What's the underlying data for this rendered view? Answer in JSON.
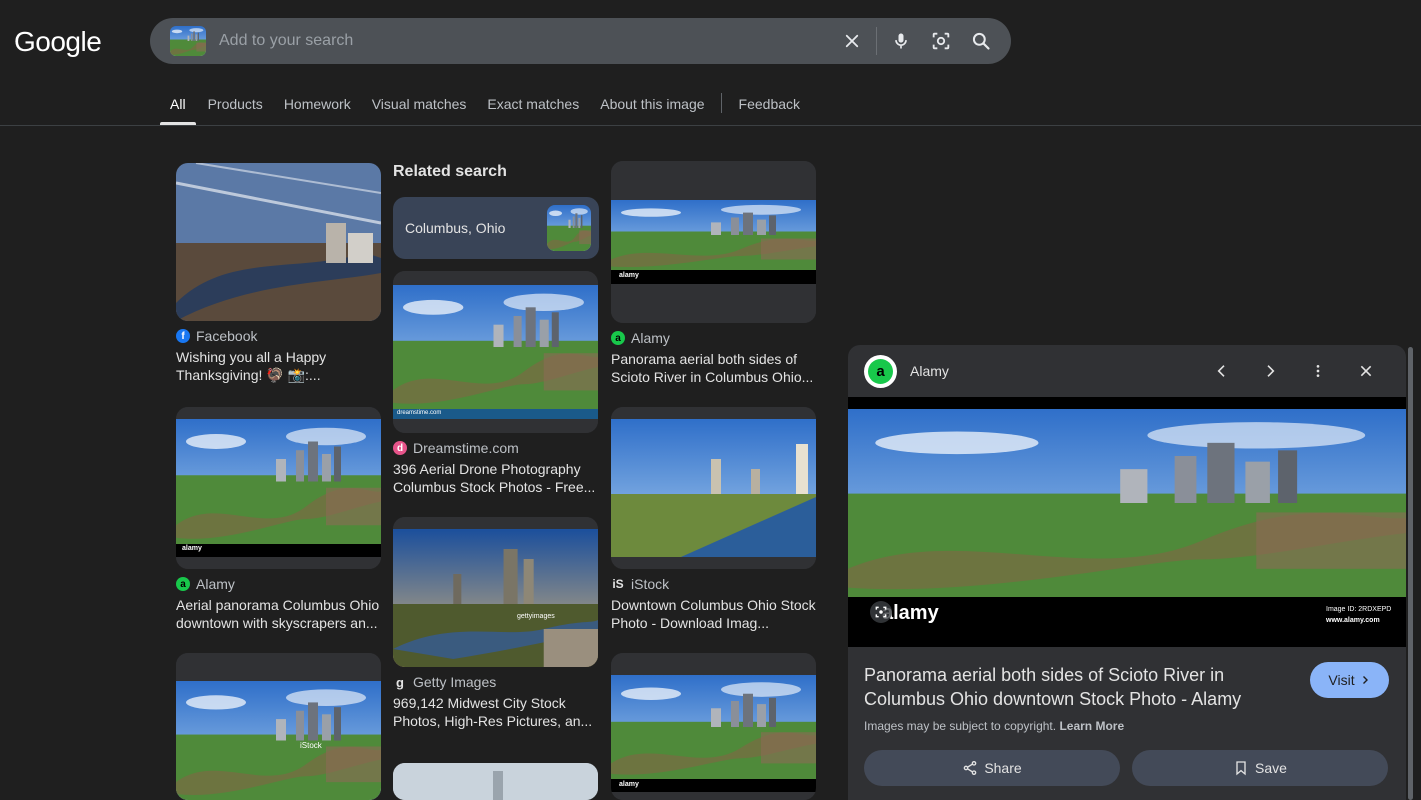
{
  "logo": "Google",
  "search": {
    "placeholder": "Add to your search"
  },
  "tabs": [
    {
      "label": "All",
      "active": true
    },
    {
      "label": "Products"
    },
    {
      "label": "Homework"
    },
    {
      "label": "Visual matches"
    },
    {
      "label": "Exact matches"
    },
    {
      "label": "About this image"
    },
    {
      "label": "Feedback"
    }
  ],
  "related": {
    "heading": "Related search",
    "chip_label": "Columbus, Ohio"
  },
  "results": {
    "c1": {
      "source": "Facebook",
      "title": "Wishing you all a Happy Thanksgiving! 🦃 📸:..."
    },
    "c2": {
      "source": "Alamy",
      "title": "Aerial panorama Columbus Ohio downtown with skyscrapers an..."
    },
    "c3": {
      "source": "Dreamstime.com",
      "title": "396 Aerial Drone Photography Columbus Stock Photos - Free..."
    },
    "c4": {
      "source": "Getty Images",
      "title": "969,142 Midwest City Stock Photos, High-Res Pictures, an..."
    },
    "c5": {
      "source": "Alamy",
      "title": "Panorama aerial both sides of Scioto River in Columbus Ohio..."
    },
    "c6": {
      "source": "iStock",
      "title": "Downtown Columbus Ohio Stock Photo - Download Imag..."
    }
  },
  "watermarks": {
    "alamy": "alamy",
    "dreamstime": "dreamstime.com",
    "getty": "gettyimages",
    "istock": "iStock"
  },
  "panel": {
    "source": "Alamy",
    "title": "Panorama aerial both sides of Scioto River in Columbus Ohio downtown Stock Photo - Alamy",
    "visit_label": "Visit",
    "copyright": "Images may be subject to copyright.",
    "learn_more": "Learn More",
    "share_label": "Share",
    "save_label": "Save",
    "image_id": "Image ID: 2RDXEPD",
    "image_site": "www.alamy.com"
  },
  "colors": {
    "background": "#1f1f1f",
    "accent": "#8ab4f8",
    "chip": "#394457"
  }
}
